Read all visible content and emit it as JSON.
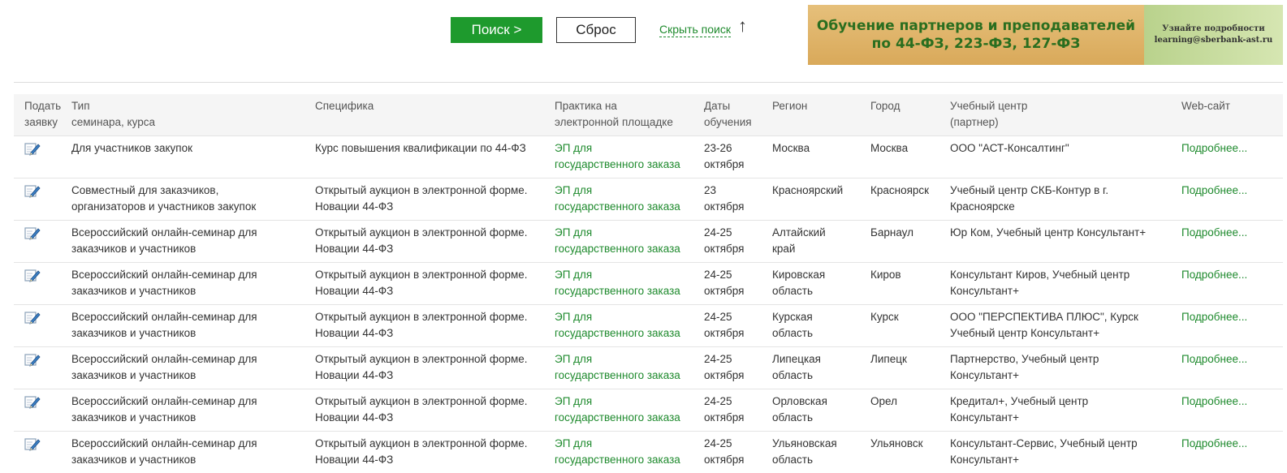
{
  "search": {
    "search_label": "Поиск  >",
    "reset_label": "Сброс",
    "hide_label": "Скрыть поиск",
    "hide_arrow": "↑"
  },
  "banner": {
    "line1": "Обучение партнеров и преподавателей",
    "line2": "по 44-ФЗ, 223-ФЗ, 127-ФЗ",
    "side_line1": "Узнайте подробности",
    "side_line2": "learning@sberbank-ast.ru"
  },
  "table": {
    "headers": {
      "apply_1": "Подать",
      "apply_2": "заявку",
      "type_1": "Тип",
      "type_2": "семинара, курса",
      "spec": "Специфика",
      "practice_1": "Практика на",
      "practice_2": "электронной площадке",
      "dates_1": "Даты",
      "dates_2": "обучения",
      "region": "Регион",
      "city": "Город",
      "center_1": "Учебный центр",
      "center_2": "(партнер)",
      "web": "Web-сайт"
    },
    "rows": [
      {
        "type_1": "Для участников закупок",
        "type_2": "",
        "spec_1": "Курс повышения квалификации по 44-ФЗ",
        "spec_2": "",
        "practice_1": "ЭП для",
        "practice_2": "государственного заказа",
        "dates_1": "23-26",
        "dates_2": "октября",
        "region_1": "Москва",
        "region_2": "",
        "city": "Москва",
        "center_1": "ООО \"АСТ-Консалтинг\"",
        "center_2": "",
        "web": "Подробнее..."
      },
      {
        "type_1": "Совместный для заказчиков,",
        "type_2": "организаторов и участников закупок",
        "spec_1": "Открытый аукцион в электронной форме.",
        "spec_2": "Новации 44-ФЗ",
        "practice_1": "ЭП для",
        "practice_2": "государственного заказа",
        "dates_1": "23",
        "dates_2": "октября",
        "region_1": "Красноярский",
        "region_2": "",
        "city": "Красноярск",
        "center_1": "Учебный центр СКБ-Контур в г.",
        "center_2": "Красноярске",
        "web": "Подробнее..."
      },
      {
        "type_1": "Всероссийский онлайн-семинар для",
        "type_2": "заказчиков и участников",
        "spec_1": "Открытый аукцион в электронной форме.",
        "spec_2": "Новации 44-ФЗ",
        "practice_1": "ЭП для",
        "practice_2": "государственного заказа",
        "dates_1": "24-25",
        "dates_2": "октября",
        "region_1": "Алтайский",
        "region_2": "край",
        "city": "Барнаул",
        "center_1": "Юр Ком, Учебный центр Консультант+",
        "center_2": "",
        "web": "Подробнее..."
      },
      {
        "type_1": "Всероссийский онлайн-семинар для",
        "type_2": "заказчиков и участников",
        "spec_1": "Открытый аукцион в электронной форме.",
        "spec_2": "Новации 44-ФЗ",
        "practice_1": "ЭП для",
        "practice_2": "государственного заказа",
        "dates_1": "24-25",
        "dates_2": "октября",
        "region_1": "Кировская",
        "region_2": "область",
        "city": "Киров",
        "center_1": "Консультант Киров, Учебный центр",
        "center_2": "Консультант+",
        "web": "Подробнее..."
      },
      {
        "type_1": "Всероссийский онлайн-семинар для",
        "type_2": "заказчиков и участников",
        "spec_1": "Открытый аукцион в электронной форме.",
        "spec_2": "Новации 44-ФЗ",
        "practice_1": "ЭП для",
        "practice_2": "государственного заказа",
        "dates_1": "24-25",
        "dates_2": "октября",
        "region_1": "Курская",
        "region_2": "область",
        "city": "Курск",
        "center_1": "ООО \"ПЕРСПЕКТИВА ПЛЮС\", Курск",
        "center_2": "Учебный центр Консультант+",
        "web": "Подробнее..."
      },
      {
        "type_1": "Всероссийский онлайн-семинар для",
        "type_2": "заказчиков и участников",
        "spec_1": "Открытый аукцион в электронной форме.",
        "spec_2": "Новации 44-ФЗ",
        "practice_1": "ЭП для",
        "practice_2": "государственного заказа",
        "dates_1": "24-25",
        "dates_2": "октября",
        "region_1": "Липецкая",
        "region_2": "область",
        "city": "Липецк",
        "center_1": "Партнерство, Учебный центр",
        "center_2": "Консультант+",
        "web": "Подробнее..."
      },
      {
        "type_1": "Всероссийский онлайн-семинар для",
        "type_2": "заказчиков и участников",
        "spec_1": "Открытый аукцион в электронной форме.",
        "spec_2": "Новации 44-ФЗ",
        "practice_1": "ЭП для",
        "practice_2": "государственного заказа",
        "dates_1": "24-25",
        "dates_2": "октября",
        "region_1": "Орловская",
        "region_2": "область",
        "city": "Орел",
        "center_1": "Кредитал+, Учебный центр",
        "center_2": "Консультант+",
        "web": "Подробнее..."
      },
      {
        "type_1": "Всероссийский онлайн-семинар для",
        "type_2": "заказчиков и участников",
        "spec_1": "Открытый аукцион в электронной форме.",
        "spec_2": "Новации 44-ФЗ",
        "practice_1": "ЭП для",
        "practice_2": "государственного заказа",
        "dates_1": "24-25",
        "dates_2": "октября",
        "region_1": "Ульяновская",
        "region_2": "область",
        "city": "Ульяновск",
        "center_1": "Консультант-Сервис, Учебный центр",
        "center_2": "Консультант+",
        "web": "Подробнее..."
      }
    ]
  },
  "colors": {
    "accent_green": "#1e9a2d",
    "link_green": "#1e8a2d",
    "banner_gold": "#e0b86d",
    "banner_text_green": "#2a6e1f"
  },
  "icons": {
    "apply": "edit-pencil-icon",
    "hide": "arrow-up-icon"
  }
}
